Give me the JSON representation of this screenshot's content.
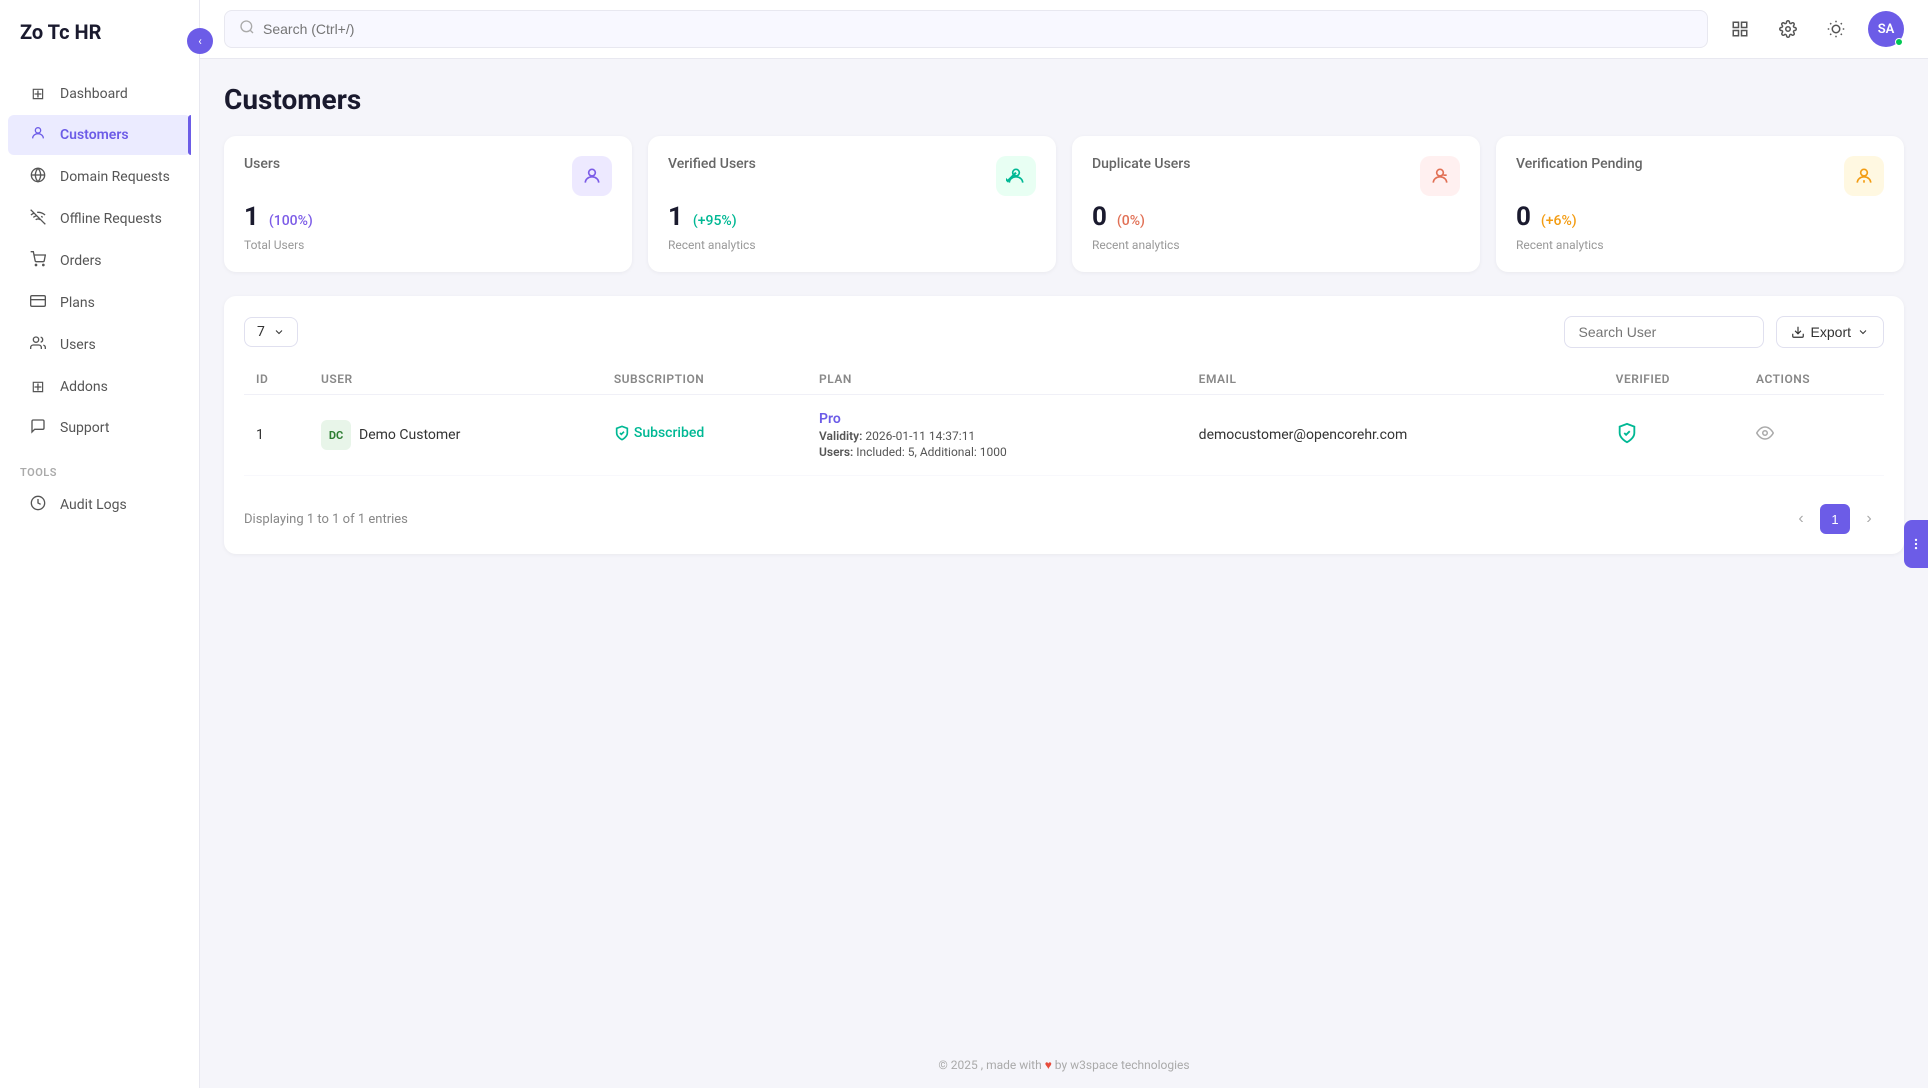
{
  "app": {
    "title": "Zo Tc HR"
  },
  "sidebar": {
    "nav_items": [
      {
        "id": "dashboard",
        "label": "Dashboard",
        "icon": "⊞",
        "active": false
      },
      {
        "id": "customers",
        "label": "Customers",
        "icon": "👤",
        "active": true
      },
      {
        "id": "domain-requests",
        "label": "Domain Requests",
        "icon": "🌐",
        "active": false
      },
      {
        "id": "offline-requests",
        "label": "Offline Requests",
        "icon": "📡",
        "active": false
      },
      {
        "id": "orders",
        "label": "Orders",
        "icon": "🛒",
        "active": false
      },
      {
        "id": "plans",
        "label": "Plans",
        "icon": "💳",
        "active": false
      },
      {
        "id": "users",
        "label": "Users",
        "icon": "👥",
        "active": false
      },
      {
        "id": "addons",
        "label": "Addons",
        "icon": "⊞",
        "active": false
      },
      {
        "id": "support",
        "label": "Support",
        "icon": "🎧",
        "active": false
      }
    ],
    "tools_label": "TOOLS",
    "tools_items": [
      {
        "id": "audit-logs",
        "label": "Audit Logs",
        "icon": "📋",
        "active": false
      }
    ]
  },
  "topbar": {
    "search_placeholder": "Search (Ctrl+/)",
    "avatar_initials": "SA"
  },
  "page": {
    "title": "Customers"
  },
  "stats": [
    {
      "label": "Users",
      "value": "1",
      "percent": "(100%)",
      "percent_class": "purple",
      "sublabel": "Total Users",
      "icon": "👤",
      "icon_class": "purple"
    },
    {
      "label": "Verified Users",
      "value": "1",
      "percent": "(+95%)",
      "percent_class": "green",
      "sublabel": "Recent analytics",
      "icon": "✅",
      "icon_class": "green"
    },
    {
      "label": "Duplicate Users",
      "value": "0",
      "percent": "(0%)",
      "percent_class": "red",
      "sublabel": "Recent analytics",
      "icon": "👤",
      "icon_class": "red"
    },
    {
      "label": "Verification Pending",
      "value": "0",
      "percent": "(+6%)",
      "percent_class": "orange",
      "sublabel": "Recent analytics",
      "icon": "⏳",
      "icon_class": "orange"
    }
  ],
  "table": {
    "per_page": "7",
    "search_placeholder": "Search User",
    "export_label": "Export",
    "columns": [
      "ID",
      "USER",
      "SUBSCRIPTION",
      "PLAN",
      "EMAIL",
      "VERIFIED",
      "ACTIONS"
    ],
    "rows": [
      {
        "id": "1",
        "user_initials": "DC",
        "user_name": "Demo Customer",
        "subscription": "Subscribed",
        "plan_name": "Pro",
        "plan_validity_label": "Validity:",
        "plan_validity": "2026-01-11 14:37:11",
        "plan_users_label": "Users:",
        "plan_users": "Included: 5, Additional: 1000",
        "email": "democustomer@opencorehr.com",
        "verified": true
      }
    ],
    "pagination_info": "Displaying 1 to 1 of 1 entries",
    "current_page": "1"
  },
  "footer": {
    "text": "© 2025 , made with",
    "by_text": "by w3space technologies"
  }
}
